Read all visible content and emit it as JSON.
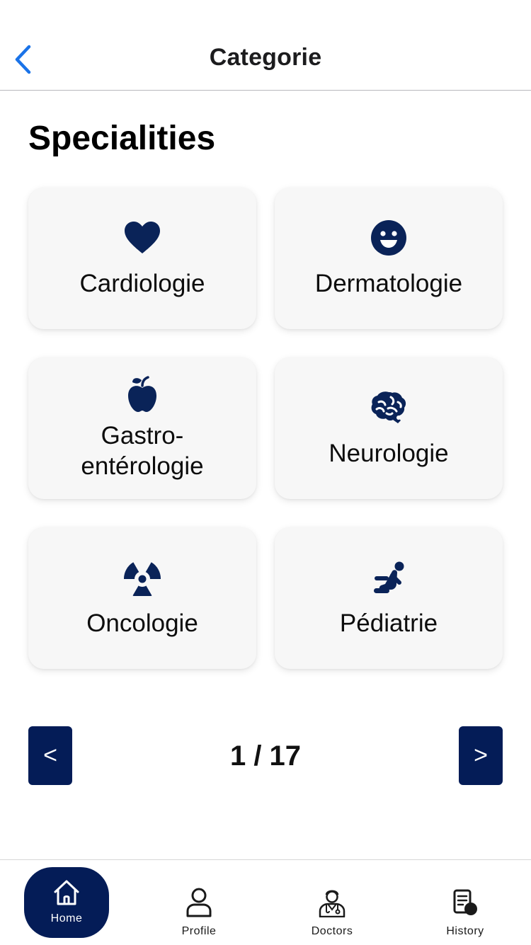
{
  "header": {
    "title": "Categorie",
    "back_icon": "chevron-left-icon",
    "accent_color": "#1a73e8"
  },
  "section": {
    "title": "Specialities"
  },
  "specialities": [
    {
      "label": "Cardiologie",
      "icon": "heart-icon"
    },
    {
      "label": "Dermatologie",
      "icon": "smiley-icon"
    },
    {
      "label": "Gastro-\nentérologie",
      "icon": "apple-icon"
    },
    {
      "label": "Neurologie",
      "icon": "brain-icon"
    },
    {
      "label": "Oncologie",
      "icon": "radiation-icon"
    },
    {
      "label": "Pédiatrie",
      "icon": "child-icon"
    }
  ],
  "pagination": {
    "prev_label": "<",
    "next_label": ">",
    "count": "1 / 17"
  },
  "tabbar": {
    "items": [
      {
        "label": "Home",
        "icon": "house-icon",
        "active": true
      },
      {
        "label": "Profile",
        "icon": "user-icon",
        "active": false
      },
      {
        "label": "Doctors",
        "icon": "doctor-icon",
        "active": false
      },
      {
        "label": "History",
        "icon": "history-icon",
        "active": false
      }
    ]
  },
  "colors": {
    "primary": "#041c57",
    "card_bg": "#f7f7f7",
    "icon": "#0a2358"
  }
}
